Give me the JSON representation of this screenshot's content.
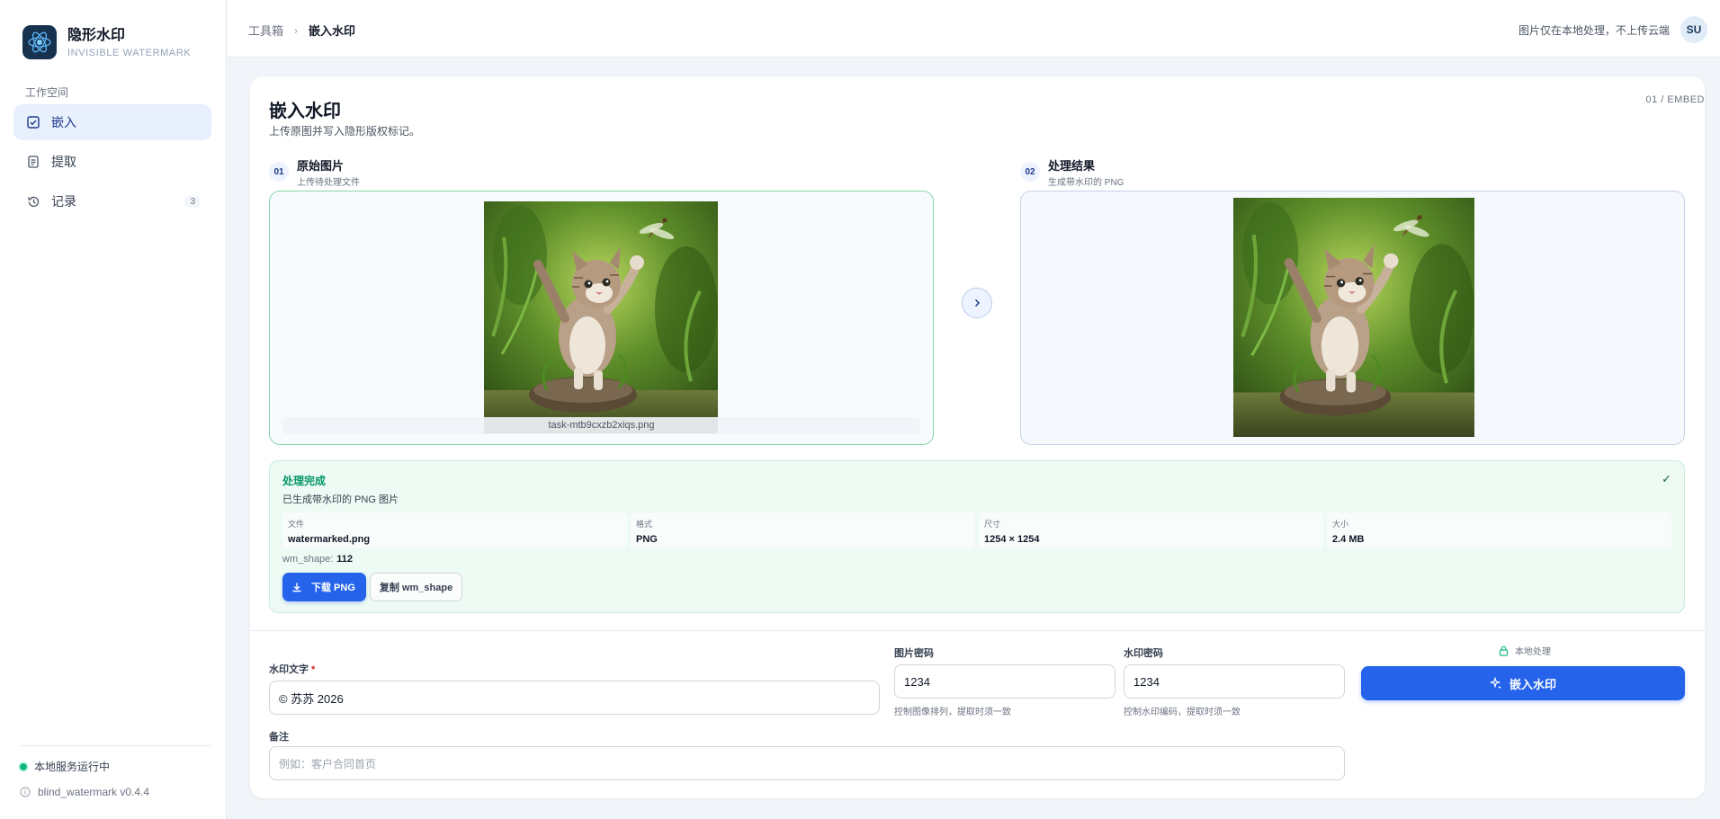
{
  "brand": {
    "title": "隐形水印",
    "subtitle": "INVISIBLE WATERMARK"
  },
  "sidebar": {
    "section_label": "工作空间",
    "items": [
      {
        "label": "嵌入",
        "icon": "check-square-icon",
        "active": true
      },
      {
        "label": "提取",
        "icon": "document-icon",
        "active": false
      },
      {
        "label": "记录",
        "icon": "history-icon",
        "active": false,
        "count": "3"
      }
    ],
    "status": "本地服务运行中",
    "version": "blind_watermark v0.4.4"
  },
  "topbar": {
    "breadcrumb": [
      "工具箱",
      "嵌入水印"
    ],
    "note": "图片仅在本地处理，不上传云端",
    "avatar": "SU"
  },
  "main": {
    "title": "嵌入水印",
    "subtitle": "上传原图并写入隐形版权标记。",
    "step_tag": "01 / EMBED",
    "source": {
      "num": "01",
      "title": "原始图片",
      "subtitle": "上传待处理文件",
      "filename": "task-mtb9cxzb2xiqs.png"
    },
    "output": {
      "num": "02",
      "title": "处理结果",
      "subtitle": "生成带水印的 PNG"
    },
    "result": {
      "title": "处理完成",
      "subtitle": "已生成带水印的 PNG 图片",
      "meta": [
        {
          "label": "文件",
          "value": "watermarked.png"
        },
        {
          "label": "格式",
          "value": "PNG"
        },
        {
          "label": "尺寸",
          "value": "1254 × 1254"
        },
        {
          "label": "大小",
          "value": "2.4 MB"
        }
      ],
      "wm_shape_label": "wm_shape:",
      "wm_shape_value": "112",
      "download_label": "下载 PNG",
      "copy_label": "复制 wm_shape"
    },
    "form": {
      "watermark_text_label": "水印文字",
      "watermark_text_required": "*",
      "watermark_text_value": "© 苏苏 2026",
      "image_key_label": "图片密码",
      "image_key_value": "1234",
      "image_key_help": "控制图像排列，提取时须一致",
      "wm_key_label": "水印密码",
      "wm_key_value": "1234",
      "wm_key_help": "控制水印编码，提取时须一致",
      "local_note": "本地处理",
      "embed_label": "嵌入水印",
      "note_label": "备注",
      "note_placeholder": "例如：客户合同首页"
    }
  },
  "colors": {
    "accent": "#2563eb",
    "success": "#059669",
    "sidebar_active_bg": "#e8f0fe"
  }
}
